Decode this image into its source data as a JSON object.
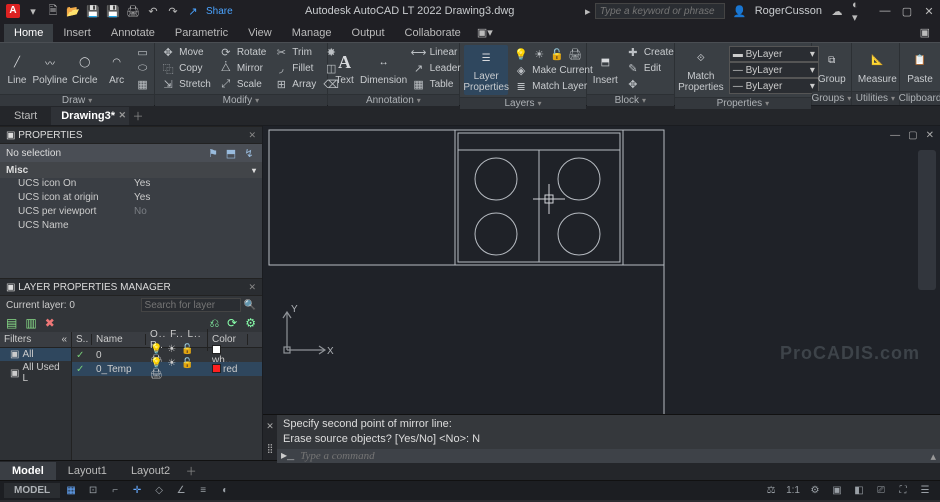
{
  "app": {
    "title": "Autodesk AutoCAD LT 2022    Drawing3.dwg",
    "search_placeholder": "Type a keyword or phrase",
    "user": "RogerCusson",
    "share": "Share"
  },
  "menu": [
    "Home",
    "Insert",
    "Annotate",
    "Parametric",
    "View",
    "Manage",
    "Output",
    "Collaborate"
  ],
  "ribbon": {
    "draw": {
      "cap": "Draw",
      "line": "Line",
      "polyline": "Polyline",
      "circle": "Circle",
      "arc": "Arc"
    },
    "modify": {
      "cap": "Modify",
      "move": "Move",
      "rotate": "Rotate",
      "trim": "Trim",
      "copy": "Copy",
      "mirror": "Mirror",
      "fillet": "Fillet",
      "stretch": "Stretch",
      "scale": "Scale",
      "array": "Array"
    },
    "annotation": {
      "cap": "Annotation",
      "text": "Text",
      "dimension": "Dimension",
      "linear": "Linear",
      "leader": "Leader",
      "table": "Table"
    },
    "layers": {
      "cap": "Layers",
      "layerprops": "Layer\nProperties",
      "make": "Make Current",
      "match": "Match Layer"
    },
    "block": {
      "cap": "Block",
      "insert": "Insert",
      "create": "Create",
      "edit": "Edit"
    },
    "props": {
      "cap": "Properties",
      "match": "Match\nProperties",
      "bylayer": "ByLayer"
    },
    "groups": {
      "cap": "Groups",
      "group": "Group"
    },
    "util": {
      "cap": "Utilities",
      "measure": "Measure"
    },
    "clip": {
      "cap": "Clipboard",
      "paste": "Paste"
    }
  },
  "doctabs": {
    "start": "Start",
    "active": "Drawing3*"
  },
  "properties": {
    "title": "PROPERTIES",
    "selection": "No selection",
    "cat": "Misc",
    "rows": [
      {
        "k": "UCS icon On",
        "v": "Yes"
      },
      {
        "k": "UCS icon at origin",
        "v": "Yes"
      },
      {
        "k": "UCS per viewport",
        "v": "No"
      },
      {
        "k": "UCS Name",
        "v": ""
      }
    ]
  },
  "lpm": {
    "title": "LAYER PROPERTIES MANAGER",
    "current": "Current layer: 0",
    "search_placeholder": "Search for layer",
    "filters_head": "Filters",
    "filter_all": "All",
    "filter_used": "All Used L",
    "head": {
      "s": "S..",
      "name": "Name",
      "flags": "O.. F.. L.. P..",
      "color": "Color"
    },
    "rows": [
      {
        "name": "0",
        "color": "wh…",
        "swatch": "#ffffff",
        "sel": false,
        "status": "✓"
      },
      {
        "name": "0_Temp",
        "color": "red",
        "swatch": "#ff2020",
        "sel": true,
        "status": "✓"
      }
    ],
    "flag_glyphs": "💡 ☀ 🔓 🖨"
  },
  "cmd": {
    "hist1": "Specify second point of mirror line:",
    "hist2": "Erase source objects? [Yes/No] <No>: N",
    "placeholder": "Type a command"
  },
  "btabs": [
    "Model",
    "Layout1",
    "Layout2"
  ],
  "status": {
    "left": "MODEL",
    "scale": "1:1"
  },
  "watermark": "ProCADIS.com",
  "ucs": {
    "x": "X",
    "y": "Y"
  }
}
